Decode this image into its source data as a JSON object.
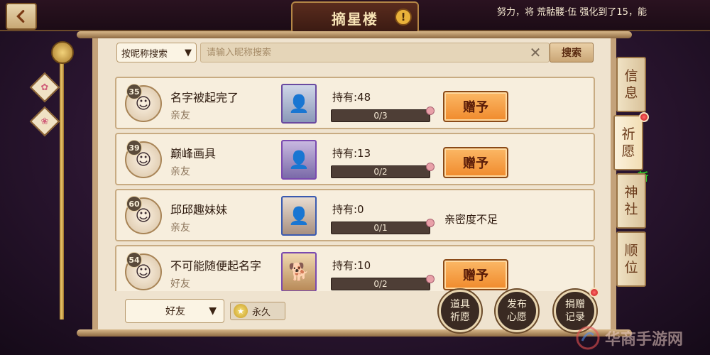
{
  "header": {
    "title": "摘星楼",
    "alert_icon": "!",
    "ticker": "努力，将 荒骷髅·伍 强化到了15，能"
  },
  "search": {
    "mode_label": "按昵称搜索",
    "placeholder": "请输入昵称搜索",
    "button_label": "搜索"
  },
  "friends": [
    {
      "level": "35",
      "name": "名字被起完了",
      "relation": "亲友",
      "hold": "持有:48",
      "progress_text": "0/3",
      "progress": 0.0,
      "action": "赠予"
    },
    {
      "level": "39",
      "name": "巅峰画具",
      "relation": "亲友",
      "hold": "持有:13",
      "progress_text": "0/2",
      "progress": 0.0,
      "action": "赠予"
    },
    {
      "level": "60",
      "name": "邱邱趣妹妹",
      "relation": "亲友",
      "hold": "持有:0",
      "progress_text": "0/1",
      "progress": 0.0,
      "action": "亲密度不足"
    },
    {
      "level": "54",
      "name": "不可能随便起名字",
      "relation": "好友",
      "hold": "持有:10",
      "progress_text": "0/2",
      "progress": 0.0,
      "action": "赠予"
    }
  ],
  "bottom": {
    "filter_label": "好友",
    "duration_label": "永久",
    "item_wish": "道具祈愿",
    "post_wish": "发布心愿",
    "donation_log": "捐赠记录"
  },
  "tabs": {
    "info": "信息",
    "wish": "祈愿",
    "shrine": "神社",
    "rank": "顺位",
    "new_badge": "新"
  },
  "watermark": "华商手游网",
  "colors": {
    "accent_orange": "#f08a2c",
    "notification_red": "#c01818",
    "new_green": "#2fd12f"
  }
}
